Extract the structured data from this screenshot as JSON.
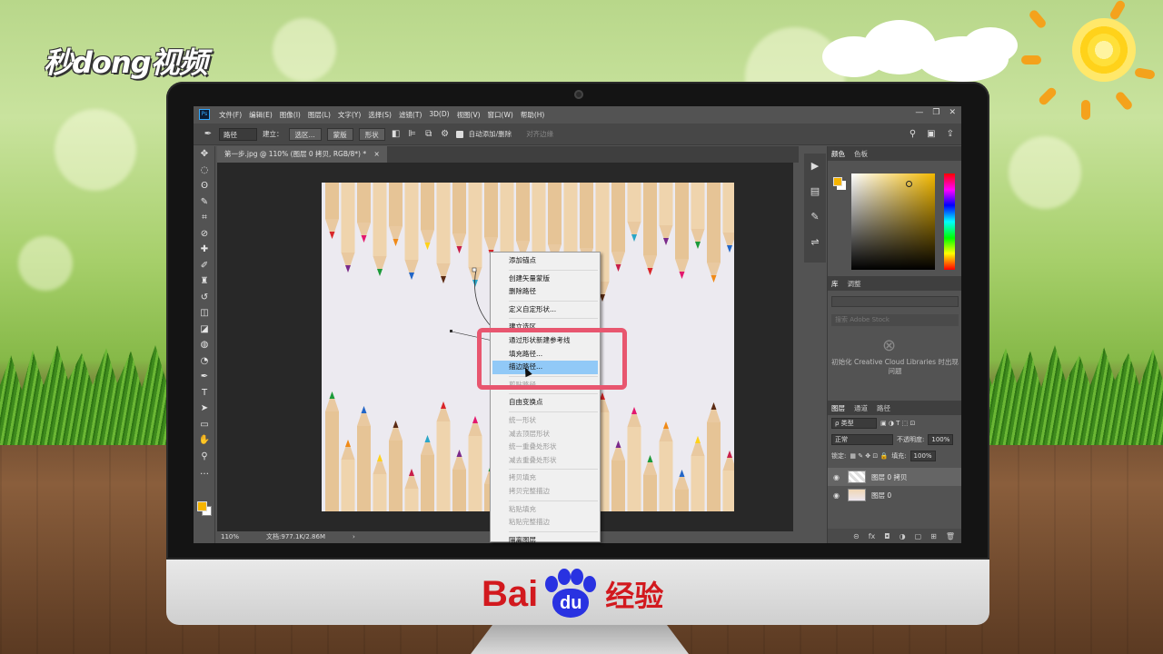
{
  "logo": {
    "text": "秒dong视频"
  },
  "branding": {
    "baidu_left": "Bai",
    "baidu_paw": "du",
    "baidu_right": "经验"
  },
  "colors": {
    "foreground": "#f5b400",
    "menu_highlight": "#91c9f7",
    "callout": "#e8566f",
    "baidu_red": "#d2191e",
    "baidu_blue": "#2932e1"
  },
  "menubar": {
    "app_icon": "Ps",
    "items": [
      "文件(F)",
      "编辑(E)",
      "图像(I)",
      "图层(L)",
      "文字(Y)",
      "选择(S)",
      "滤镜(T)",
      "3D(D)",
      "视图(V)",
      "窗口(W)",
      "帮助(H)"
    ]
  },
  "options_bar": {
    "tool_icon": "pen-icon",
    "mode_select": "路径",
    "make_label": "建立：",
    "selection_button": "选区...",
    "mask_button": "蒙版",
    "shape_button": "形状",
    "auto_add_delete": "自动添加/删除",
    "align_edges": "对齐边缘"
  },
  "document_tab": {
    "title": "第一步.jpg @ 110% (图层 0 拷贝, RGB/8*) *",
    "close": "×"
  },
  "statusbar": {
    "zoom": "110%",
    "doc_size": "文档:977.1K/2.86M",
    "arrow": "›"
  },
  "tools": [
    "move-icon",
    "marquee-icon",
    "lasso-icon",
    "quick-select-icon",
    "crop-icon",
    "eyedropper-icon",
    "healing-icon",
    "brush-icon",
    "stamp-icon",
    "history-brush-icon",
    "eraser-icon",
    "gradient-icon",
    "blur-icon",
    "dodge-icon",
    "pen-icon",
    "type-icon",
    "path-select-icon",
    "rectangle-icon",
    "hand-icon",
    "zoom-icon",
    "more-icon"
  ],
  "tool_glyphs": [
    "✥",
    "◌",
    "ʘ",
    "✎",
    "⌗",
    "⊘",
    "✚",
    "✐",
    "♜",
    "↺",
    "◫",
    "◪",
    "◍",
    "◔",
    "✒",
    "T",
    "➤",
    "▭",
    "✋",
    "⚲",
    "…"
  ],
  "color_panel": {
    "tab_color": "颜色",
    "tab_swatches": "色板"
  },
  "library_panel": {
    "tab_library": "库",
    "tab_adjust": "调整",
    "search_placeholder": "搜索 Adobe Stock",
    "message": "初始化 Creative Cloud Libraries 时出现问题"
  },
  "layers_panel": {
    "tab_layers": "图层",
    "tab_channels": "通道",
    "tab_paths": "路径",
    "filter_type": "ρ 类型",
    "blend_mode": "正常",
    "opacity_label": "不透明度:",
    "opacity_value": "100%",
    "lock_label": "锁定:",
    "fill_label": "填充:",
    "fill_value": "100%",
    "layers": [
      {
        "name": "图层 0 拷贝",
        "selected": true
      },
      {
        "name": "图层 0",
        "selected": false
      }
    ],
    "footer_icons": [
      "⊝",
      "fx",
      "◘",
      "◑",
      "▢",
      "⊞",
      "🗑"
    ]
  },
  "context_menu": {
    "items": [
      {
        "label": "添加锚点",
        "enabled": true
      },
      {
        "sep": true
      },
      {
        "label": "创建矢量蒙版",
        "enabled": true
      },
      {
        "label": "删除路径",
        "enabled": true
      },
      {
        "sep": true
      },
      {
        "label": "定义自定形状...",
        "enabled": true
      },
      {
        "sep": true
      },
      {
        "label": "建立选区...",
        "enabled": true
      },
      {
        "label": "通过形状新建参考线",
        "enabled": true
      },
      {
        "label": "填充路径...",
        "enabled": true
      },
      {
        "label": "描边路径...",
        "enabled": true,
        "highlighted": true
      },
      {
        "sep": true
      },
      {
        "label": "剪贴路径...",
        "enabled": false
      },
      {
        "sep": true
      },
      {
        "label": "自由变换点",
        "enabled": true
      },
      {
        "sep": true
      },
      {
        "label": "统一形状",
        "enabled": false
      },
      {
        "label": "减去顶层形状",
        "enabled": false
      },
      {
        "label": "统一重叠处形状",
        "enabled": false
      },
      {
        "label": "减去重叠处形状",
        "enabled": false
      },
      {
        "sep": true
      },
      {
        "label": "拷贝填充",
        "enabled": false
      },
      {
        "label": "拷贝完整描边",
        "enabled": false
      },
      {
        "sep": true
      },
      {
        "label": "粘贴填充",
        "enabled": false
      },
      {
        "label": "粘贴完整描边",
        "enabled": false
      },
      {
        "sep": true
      },
      {
        "label": "隔离图层",
        "enabled": true
      }
    ]
  }
}
